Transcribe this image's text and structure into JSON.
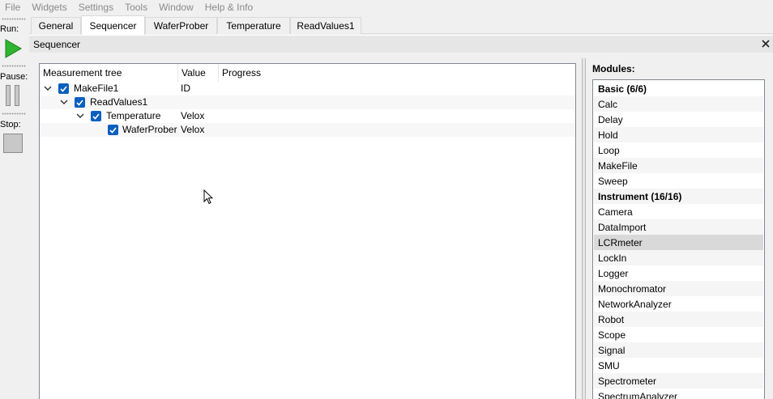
{
  "menubar": {
    "items": [
      "File",
      "Widgets",
      "Settings",
      "Tools",
      "Window",
      "Help & Info"
    ]
  },
  "toolbar": {
    "run_label": "Run:",
    "pause_label": "Pause:",
    "stop_label": "Stop:"
  },
  "tabs": [
    {
      "label": "General"
    },
    {
      "label": "Sequencer",
      "active": true
    },
    {
      "label": "WaferProber"
    },
    {
      "label": "Temperature"
    },
    {
      "label": "ReadValues1"
    }
  ],
  "panel": {
    "title": "Sequencer",
    "close_icon": "×"
  },
  "tree": {
    "headers": [
      "Measurement tree",
      "Value",
      "Progress"
    ],
    "rows": [
      {
        "name": "MakeFile1",
        "value": "ID",
        "checked": true,
        "expanded": true,
        "level": 0
      },
      {
        "name": "ReadValues1",
        "value": "",
        "checked": true,
        "expanded": true,
        "level": 1
      },
      {
        "name": "Temperature",
        "value": "Velox",
        "checked": true,
        "expanded": true,
        "level": 2
      },
      {
        "name": "WaferProber",
        "value": "Velox",
        "checked": true,
        "expanded": false,
        "level": 3
      }
    ]
  },
  "modules": {
    "label": "Modules:",
    "items": [
      {
        "label": "Basic (6/6)",
        "header": true
      },
      {
        "label": "Calc"
      },
      {
        "label": "Delay"
      },
      {
        "label": "Hold"
      },
      {
        "label": "Loop"
      },
      {
        "label": "MakeFile"
      },
      {
        "label": "Sweep"
      },
      {
        "label": "Instrument (16/16)",
        "header": true
      },
      {
        "label": "Camera"
      },
      {
        "label": "DataImport"
      },
      {
        "label": "LCRmeter",
        "selected": true
      },
      {
        "label": "LockIn"
      },
      {
        "label": "Logger"
      },
      {
        "label": "Monochromator"
      },
      {
        "label": "NetworkAnalyzer"
      },
      {
        "label": "Robot"
      },
      {
        "label": "Scope"
      },
      {
        "label": "Signal"
      },
      {
        "label": "SMU"
      },
      {
        "label": "Spectrometer"
      },
      {
        "label": "SpectrumAnalyzer"
      }
    ]
  },
  "colors": {
    "accent": "#0b5fbf",
    "run_green": "#2fb52f",
    "selection": "#d9d9d9"
  }
}
